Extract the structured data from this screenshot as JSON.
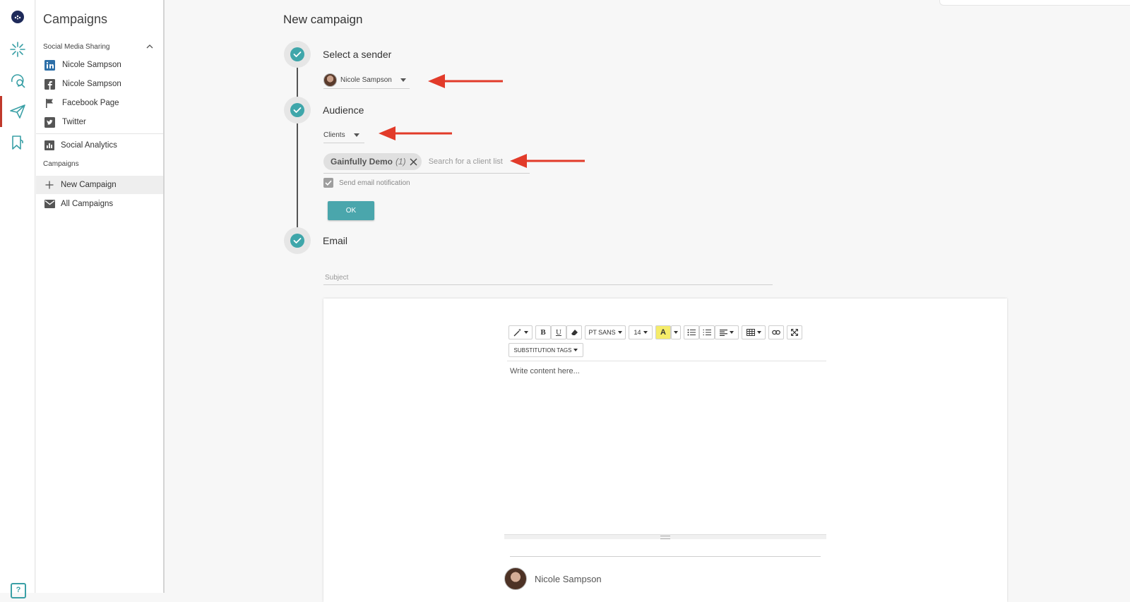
{
  "rail": {
    "items": [
      "logo-icon",
      "dashboard-icon",
      "search-icon",
      "send-icon",
      "bookmark-icon"
    ],
    "help_label": "?"
  },
  "sidebar": {
    "title": "Campaigns",
    "section_header": "Social Media Sharing",
    "items": [
      {
        "label": "Nicole Sampson",
        "icon": "linkedin-icon"
      },
      {
        "label": "Nicole Sampson",
        "icon": "facebook-icon"
      },
      {
        "label": "Facebook Page",
        "icon": "flag-icon"
      },
      {
        "label": "Twitter",
        "icon": "twitter-icon"
      },
      {
        "label": "Social Analytics",
        "icon": "bar-chart-icon"
      }
    ],
    "campaigns_caption": "Campaigns",
    "campaign_items": [
      {
        "label": "New Campaign",
        "icon": "plus-icon",
        "active": true
      },
      {
        "label": "All Campaigns",
        "icon": "envelope-icon",
        "active": false
      }
    ]
  },
  "main": {
    "page_title": "New campaign",
    "steps": {
      "sender": {
        "title": "Select a sender",
        "selected_sender": "Nicole Sampson"
      },
      "audience": {
        "title": "Audience",
        "audience_type": "Clients",
        "chip_name": "Gainfully Demo",
        "chip_count": "(1)",
        "search_placeholder": "Search for a client list",
        "notify_label": "Send email notification",
        "notify_checked": true,
        "ok_label": "OK"
      },
      "email": {
        "title": "Email",
        "subject_placeholder": "Subject",
        "toolbar": {
          "font_label": "PT SANS",
          "size_label": "14",
          "bold": "B",
          "underline": "U",
          "highlight": "A",
          "substitution_label": "SUBSTITUTION TAGS"
        },
        "content_placeholder": "Write content here...",
        "signature_name": "Nicole Sampson"
      }
    }
  },
  "colors": {
    "accent": "#4aa6ac",
    "check": "#3fa6aa",
    "annotation_arrow": "#e23b2a",
    "active_rail": "#c0392b"
  }
}
